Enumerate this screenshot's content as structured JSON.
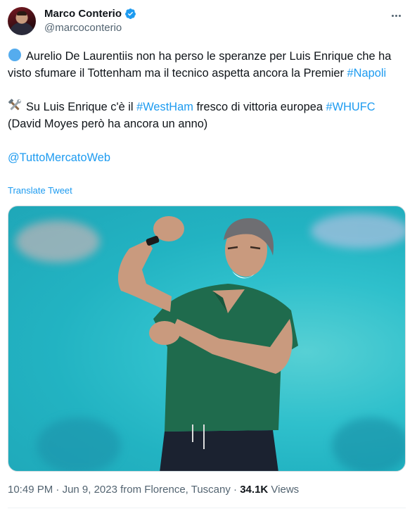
{
  "author": {
    "display_name": "Marco Conterio",
    "handle": "@marcoconterio",
    "verified": true
  },
  "tweet": {
    "line1_emoji": "blue-circle",
    "line1_text": "Aurelio De Laurentiis non ha perso le speranze per Luis Enrique che ha visto sfumare il Tottenham ma il tecnico aspetta ancora la Premier",
    "hashtag_napoli": "#Napoli",
    "line2_emoji": "hammer-and-wrench",
    "line2_prefix": "Su Luis Enrique c'è il",
    "hashtag_westham": "#WestHam",
    "line2_middle": "fresco di vittoria europea",
    "hashtag_whufc": "#WHUFC",
    "line3_text": "(David Moyes però ha ancora un anno)",
    "mention": "@TuttoMercatoWeb",
    "translate_label": "Translate Tweet"
  },
  "meta": {
    "time": "10:49 PM",
    "separator": "·",
    "date": "Jun 9, 2023",
    "location": "from Florence, Tuscany",
    "views_count": "34.1K",
    "views_label": "Views"
  },
  "colors": {
    "link": "#1d9bf0",
    "text": "#0f1419",
    "secondary": "#536471",
    "verified": "#1d9bf0",
    "shirt": "#1f6b4d",
    "photo_bg": "#2fc0cc"
  }
}
